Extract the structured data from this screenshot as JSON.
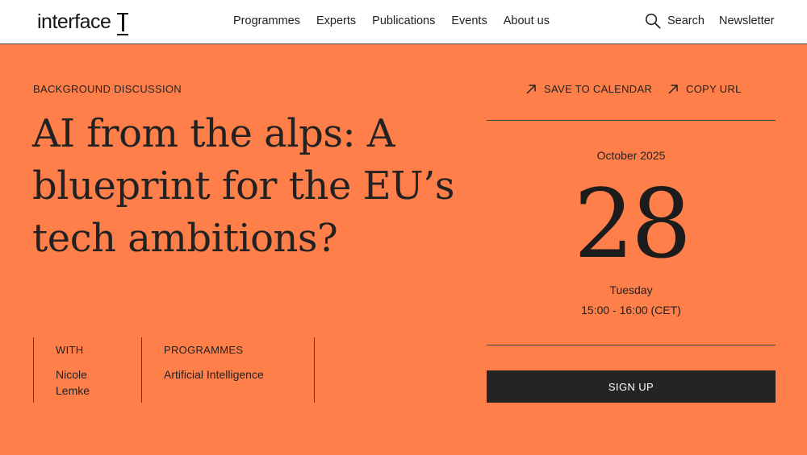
{
  "header": {
    "logo_text": "interface",
    "nav": [
      "Programmes",
      "Experts",
      "Publications",
      "Events",
      "About us"
    ],
    "search_label": "Search",
    "newsletter_label": "Newsletter"
  },
  "event": {
    "eyebrow": "BACKGROUND DISCUSSION",
    "title": "AI from the alps: A blueprint for the EU’s tech ambitions?",
    "with_label": "WITH",
    "with_value": "Nicole Lemke",
    "programmes_label": "PROGRAMMES",
    "programmes_value": "Artificial Intelligence"
  },
  "sidebar": {
    "save_calendar": "SAVE TO CALENDAR",
    "copy_url": "COPY URL",
    "month": "October 2025",
    "day": "28",
    "weekday": "Tuesday",
    "time": "15:00 - 16:00 (CET)",
    "signup": "SIGN UP"
  },
  "colors": {
    "background": "#ff7f4a",
    "header_bg": "#ffffff",
    "button_bg": "#242424",
    "text": "#222222"
  },
  "icons": {
    "logo": "i-beam-cursor-icon",
    "search": "magnifier-icon",
    "external": "arrow-up-right-icon"
  }
}
